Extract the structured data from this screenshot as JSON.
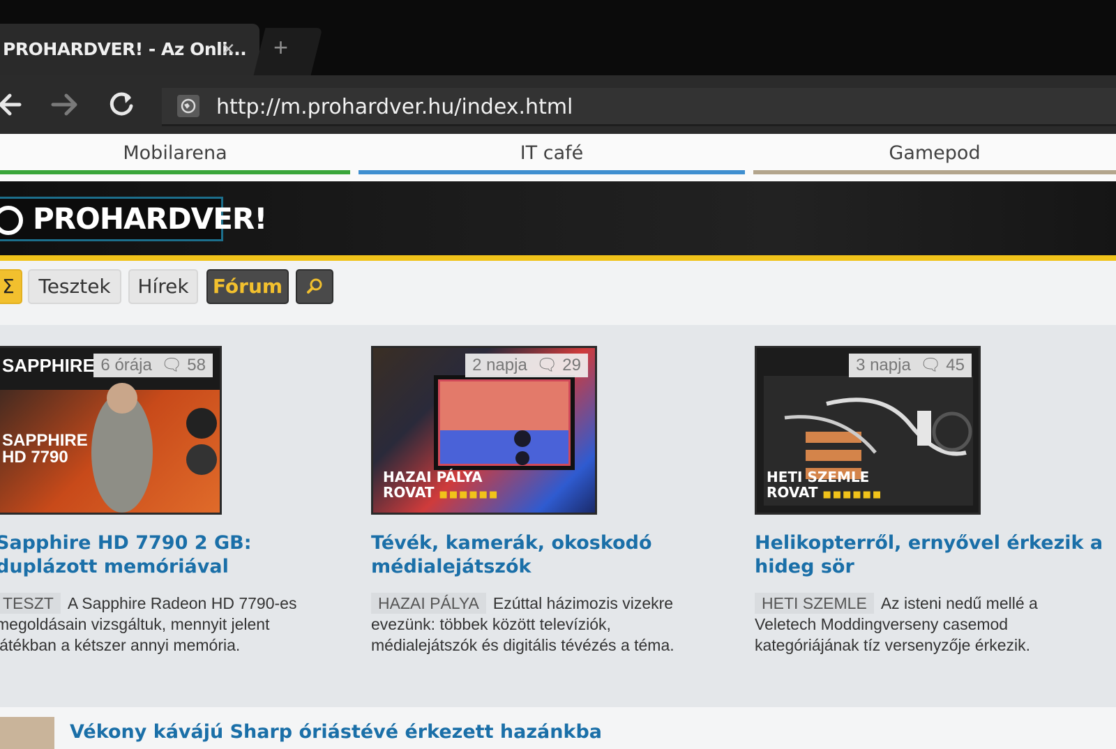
{
  "browser": {
    "tab_title": "PROHARDVER! - Az Onli...",
    "tab_close_glyph": "×",
    "new_tab_glyph": "+",
    "url": "http://m.prohardver.hu/index.html",
    "icons": [
      "back-icon",
      "forward-icon",
      "reload-icon",
      "site-globe-icon"
    ]
  },
  "sister_sites": [
    {
      "label": "Mobilarena",
      "color": "#3aa63a"
    },
    {
      "label": "IT café",
      "color": "#3f8fd0"
    },
    {
      "label": "Gamepod",
      "color": "#b3a58c"
    }
  ],
  "header": {
    "logo_text": "PROHARDVER!"
  },
  "menu": {
    "sigma": "Σ",
    "tests": "Tesztek",
    "news": "Hírek",
    "forum": "Fórum",
    "search_icon": "search-icon"
  },
  "articles": [
    {
      "age": "6 órája",
      "comments": "58",
      "title": "Sapphire HD 7790 2 GB: duplázott memóriával",
      "tag": "TESZT",
      "desc": "A Sapphire Radeon HD 7790-es megoldásain vizsgáltuk, mennyit jelent játékban a kétszer annyi memória."
    },
    {
      "age": "2 napja",
      "comments": "29",
      "overlay_line1": "HAZAI PÁLYA",
      "overlay_line2": "ROVAT",
      "title": "Tévék, kamerák, okoskodó médialejátszók",
      "tag": "HAZAI PÁLYA",
      "desc": "Ezúttal házimozis vizekre evezünk: többek között televíziók, médialejátszók és digitális tévézés a téma."
    },
    {
      "age": "3 napja",
      "comments": "45",
      "overlay_line1": "HETI SZEMLE",
      "overlay_line2": "ROVAT",
      "title": "Helikopterről, ernyővel érkezik a hideg sör",
      "tag": "HETI SZEMLE",
      "desc": "Az isteni nedű mellé a Veletech Moddingverseny casemod kategóriájának tíz versenyzője érkezik."
    }
  ],
  "list": [
    {
      "title": "Vékony kávájú Sharp óriástévé érkezett hazánkba"
    }
  ]
}
